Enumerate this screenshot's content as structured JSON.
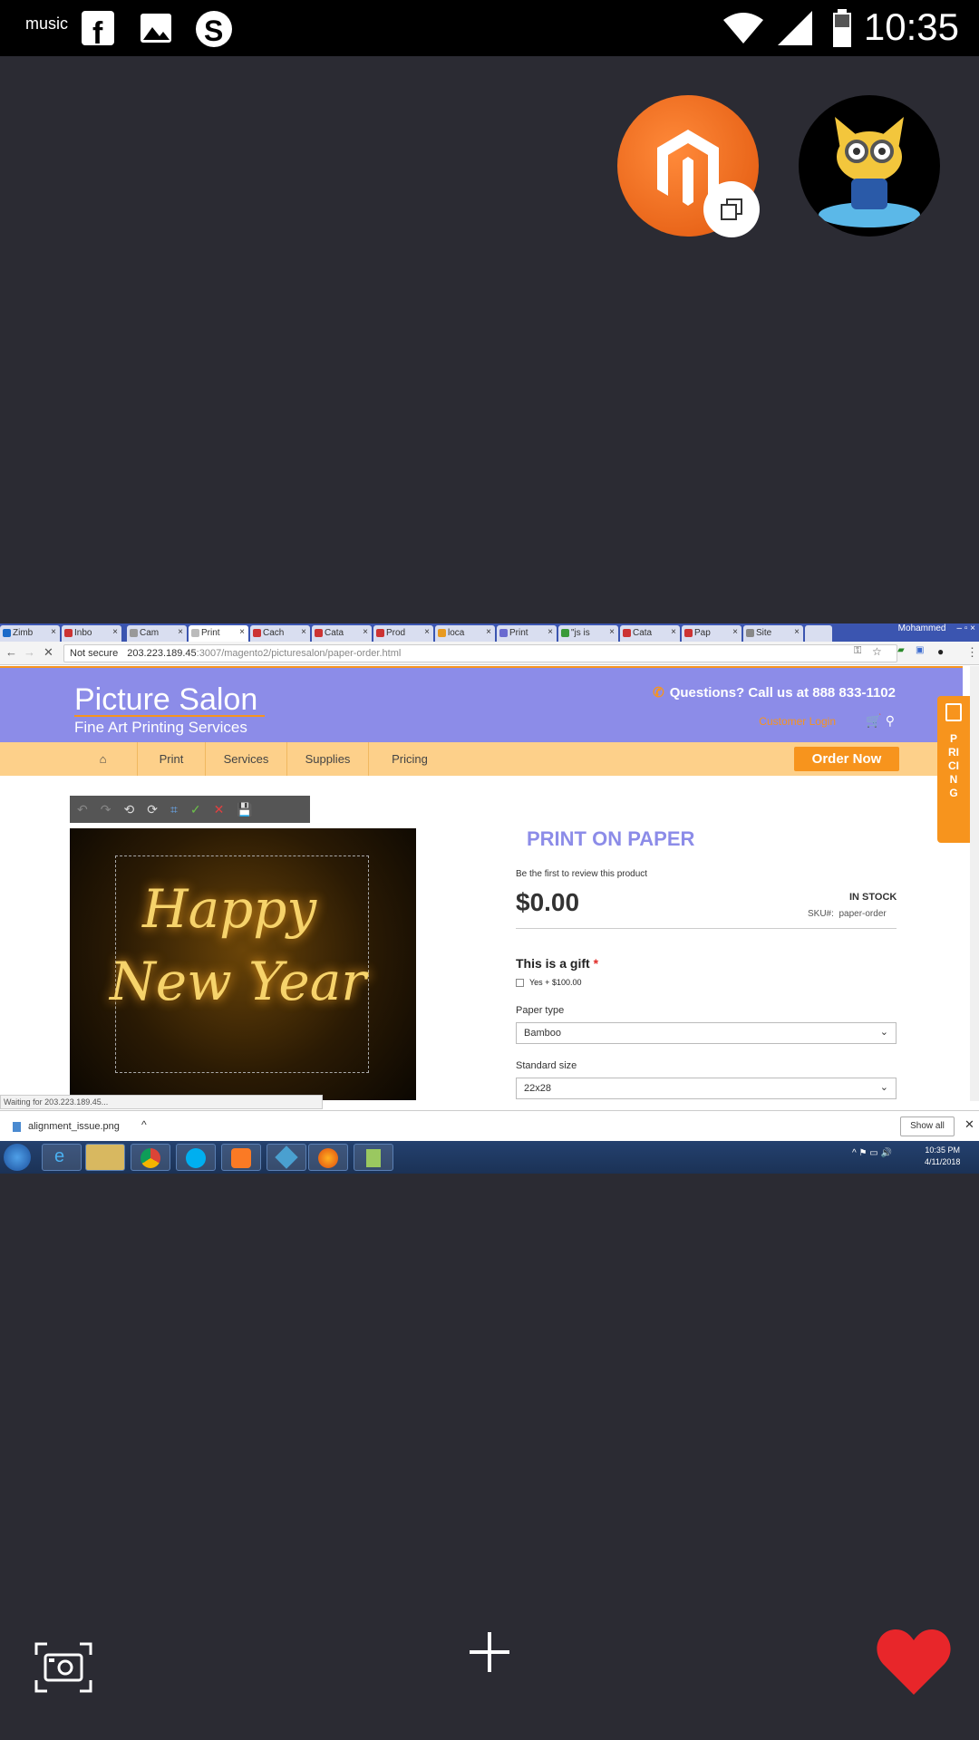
{
  "status_bar": {
    "time": "10:35",
    "icons": [
      "amazon-music-icon",
      "facebook-icon",
      "gallery-icon",
      "skype-icon",
      "wifi-icon",
      "signal-icon",
      "battery-icon"
    ],
    "music_label": "music"
  },
  "chat_heads": [
    {
      "name": "magento-chathead",
      "icon": "magento-logo"
    },
    {
      "name": "octocat-chathead",
      "icon": "octocat-minion-avatar"
    }
  ],
  "browser": {
    "tabs": [
      {
        "label": "Zimb",
        "active": false
      },
      {
        "label": "Inbo",
        "active": false
      },
      {
        "label": "Cam",
        "active": false
      },
      {
        "label": "Print",
        "active": true
      },
      {
        "label": "Cach",
        "active": false
      },
      {
        "label": "Cata",
        "active": false
      },
      {
        "label": "Prod",
        "active": false
      },
      {
        "label": "loca",
        "active": false
      },
      {
        "label": "Print",
        "active": false
      },
      {
        "label": "\"js is",
        "active": false
      },
      {
        "label": "Cata",
        "active": false
      },
      {
        "label": "Pap",
        "active": false
      },
      {
        "label": "Site",
        "active": false
      }
    ],
    "profile_name": "Mohammed",
    "security": "Not secure",
    "url_host": "203.223.189.45",
    "url_path": ":3007/magento2/picturesalon/paper-order.html"
  },
  "site": {
    "logo_title": "Picture Salon",
    "logo_subtitle": "Fine Art Printing Services",
    "questions": "Questions? Call us at 888 833-1102",
    "customer_login": "Customer Login",
    "nav": [
      "Print",
      "Services",
      "Supplies",
      "Pricing"
    ],
    "order_now": "Order Now",
    "pricing_tab": "PRICING"
  },
  "product": {
    "image_text_line1": "Happy",
    "image_text_line2": "New Year",
    "title": "PRINT ON PAPER",
    "review_prompt": "Be the first to review this product",
    "price": "$0.00",
    "stock": "IN STOCK",
    "sku_label": "SKU#:",
    "sku_value": "paper-order",
    "gift_label": "This is a gift",
    "gift_required": "*",
    "gift_option": "Yes + $100.00",
    "paper_type_label": "Paper type",
    "paper_type_value": "Bamboo",
    "standard_size_label": "Standard size",
    "standard_size_value": "22x28"
  },
  "status_text": "Waiting for 203.223.189.45...",
  "downloads": {
    "file": "alignment_issue.png",
    "show_all": "Show all"
  },
  "taskbar": {
    "time": "10:35 PM",
    "date": "4/11/2018"
  },
  "colors": {
    "header_purple": "#8c8ce8",
    "accent_orange": "#f7941d",
    "nav_peach": "#fdd08a",
    "heart_red": "#e8262a",
    "background": "#2b2b33"
  }
}
